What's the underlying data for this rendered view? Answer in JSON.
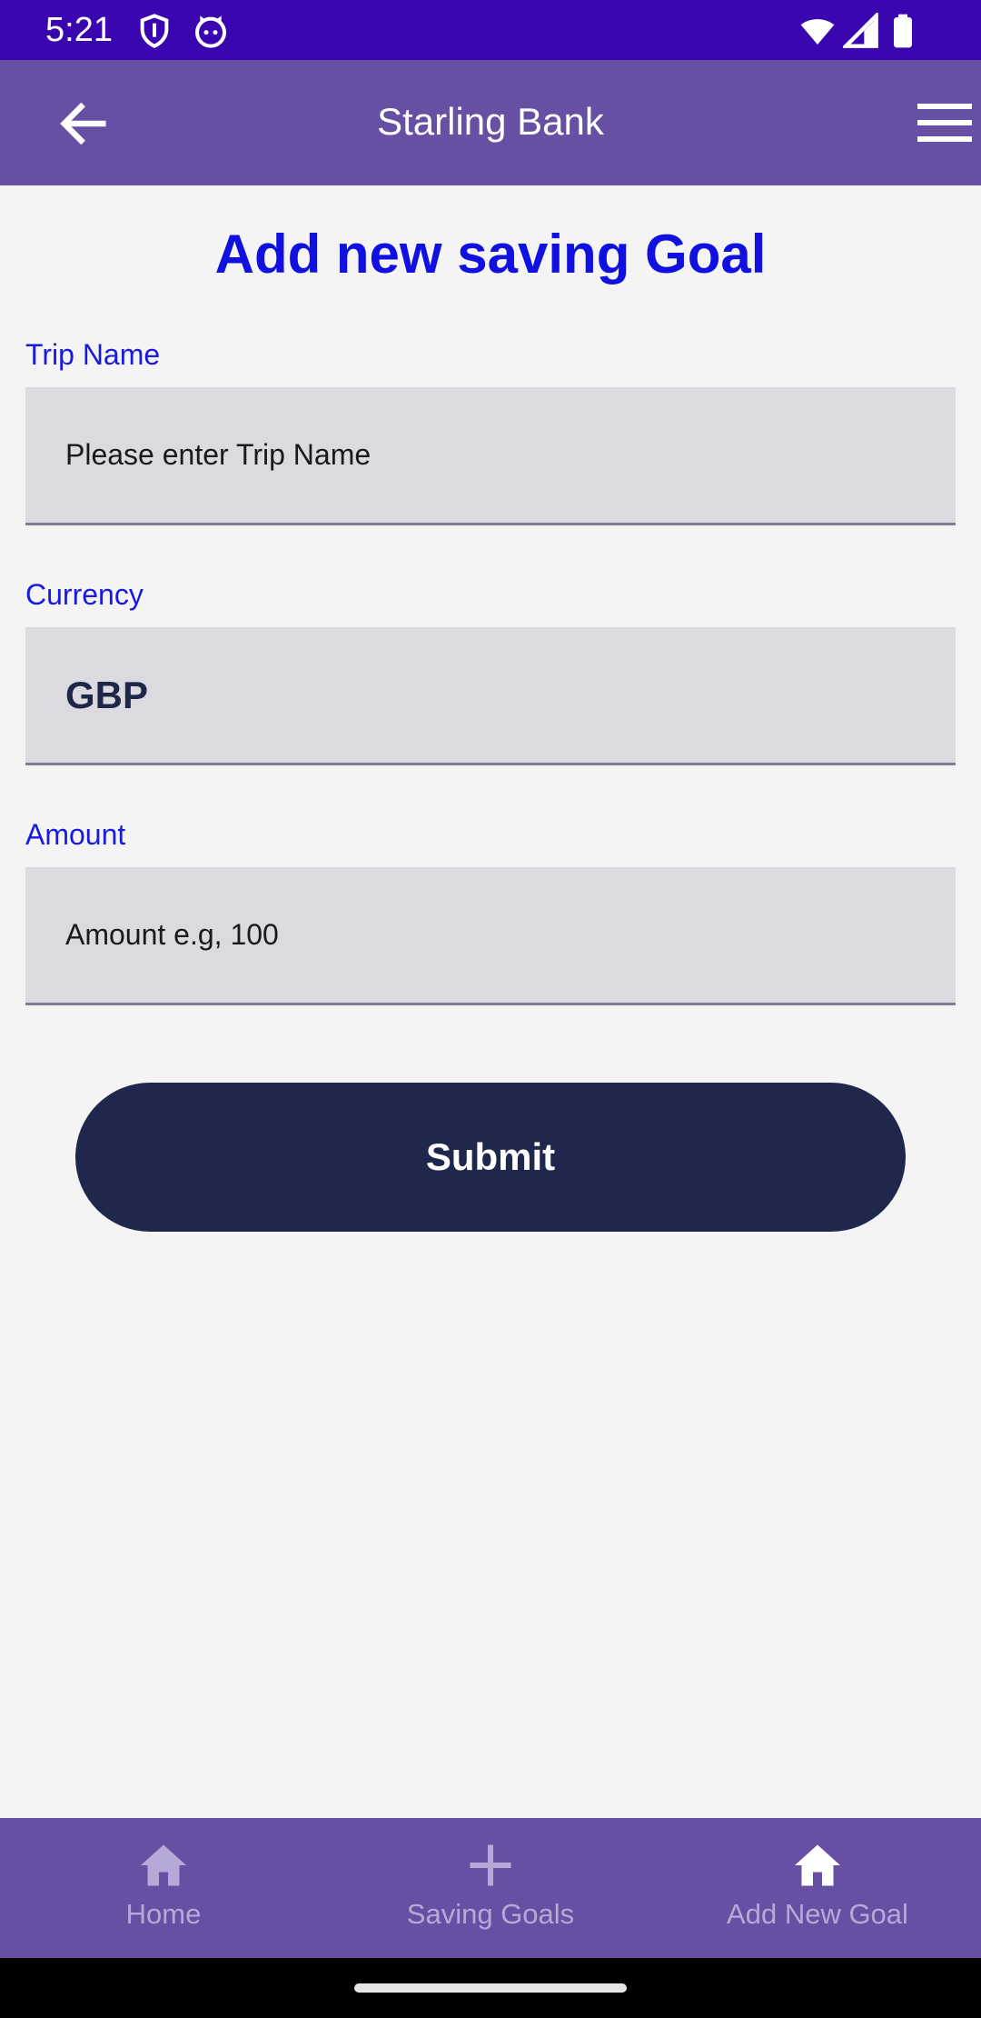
{
  "status_bar": {
    "time": "5:21",
    "icons": [
      "shield-icon",
      "cat-icon",
      "wifi-icon",
      "signal-icon",
      "battery-icon"
    ]
  },
  "app_bar": {
    "title": "Starling Bank",
    "back_icon": "arrow-left-icon",
    "menu_icon": "hamburger-menu-icon"
  },
  "form": {
    "heading": "Add new saving Goal",
    "trip_name": {
      "label": "Trip Name",
      "placeholder": "Please enter Trip Name",
      "value": ""
    },
    "currency": {
      "label": "Currency",
      "value": "GBP"
    },
    "amount": {
      "label": "Amount",
      "placeholder": "Amount e.g, 100",
      "value": ""
    },
    "submit_label": "Submit"
  },
  "bottom_nav": {
    "items": [
      {
        "label": "Home",
        "icon": "home-icon"
      },
      {
        "label": "Saving Goals",
        "icon": "plus-icon"
      },
      {
        "label": "Add New Goal",
        "icon": "home-icon",
        "selected": true
      }
    ]
  },
  "colors": {
    "status_bar": "#3a06b0",
    "app_bar": "#6750a4",
    "heading": "#1010e0",
    "label": "#1a1adf",
    "field_bg": "#dadae0",
    "button": "#1f284c",
    "nav_label": "#b6a9d8",
    "nav_selected_icon": "#ffffff"
  }
}
